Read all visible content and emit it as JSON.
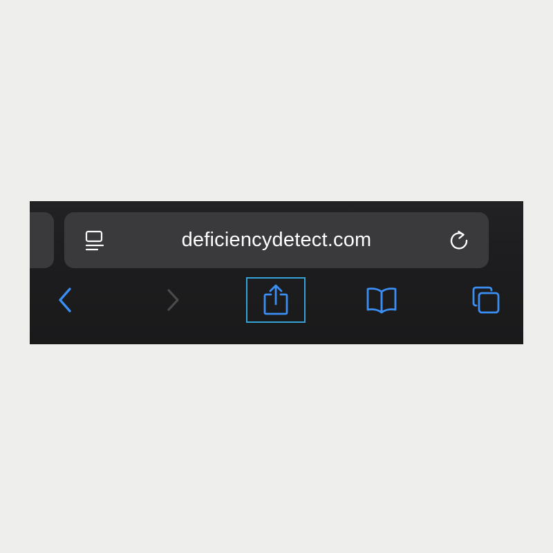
{
  "address_bar": {
    "url": "deficiencydetect.com",
    "reader_icon": "reader-mode-icon",
    "reload_icon": "reload-icon"
  },
  "toolbar": {
    "back_icon": "chevron-left-icon",
    "forward_icon": "chevron-right-icon",
    "share_icon": "share-icon",
    "bookmarks_icon": "book-icon",
    "tabs_icon": "tabs-icon",
    "share_highlighted": true,
    "forward_enabled": false
  },
  "colors": {
    "accent": "#3b8ef3",
    "disabled": "#4a4a4c",
    "highlight": "#35a3d8",
    "bar_background": "#1c1c1e",
    "field_background": "#3a3a3c",
    "page_background": "#eeeeec"
  }
}
